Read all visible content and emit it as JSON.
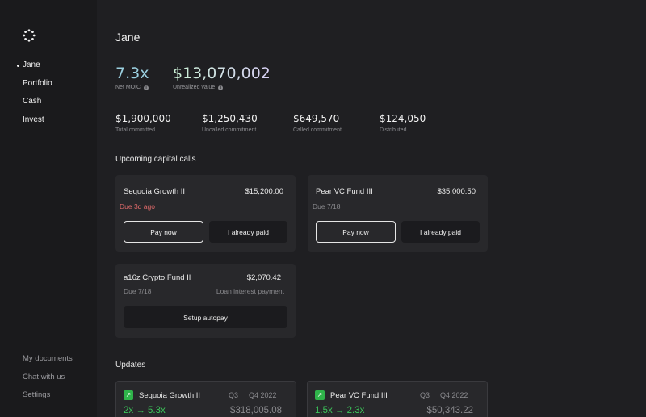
{
  "sidebar": {
    "logo_icon": "spinner-logo-icon",
    "items": [
      {
        "label": "Jane",
        "active": true
      },
      {
        "label": "Portfolio",
        "active": false
      },
      {
        "label": "Cash",
        "active": false
      },
      {
        "label": "Invest",
        "active": false
      }
    ],
    "bottom_items": [
      {
        "label": "My documents"
      },
      {
        "label": "Chat with us"
      },
      {
        "label": "Settings"
      }
    ]
  },
  "header": {
    "title": "Jane"
  },
  "summary": {
    "net_moic": {
      "value": "7.3x",
      "label": "Net MOIC"
    },
    "unrealized": {
      "value": "$13,070,002",
      "label": "Unrealized value"
    },
    "info_icon": "info-icon"
  },
  "stats": [
    {
      "value": "$1,900,000",
      "label": "Total committed"
    },
    {
      "value": "$1,250,430",
      "label": "Uncalled commitment"
    },
    {
      "value": "$649,570",
      "label": "Called commitment"
    },
    {
      "value": "$124,050",
      "label": "Distributed"
    }
  ],
  "capital_calls": {
    "title": "Upcoming capital calls",
    "cards": [
      {
        "name": "Sequoia Growth II",
        "amount": "$15,200.00",
        "due": "Due 3d ago",
        "overdue": true,
        "primary": "Pay now",
        "secondary": "I already paid"
      },
      {
        "name": "Pear VC Fund III",
        "amount": "$35,000.50",
        "due": "Due 7/18",
        "overdue": false,
        "primary": "Pay now",
        "secondary": "I already paid"
      },
      {
        "name": "a16z Crypto Fund II",
        "amount": "$2,070.42",
        "due": "Due 7/18",
        "note": "Loan interest payment",
        "action": "Setup autopay"
      }
    ]
  },
  "updates": {
    "title": "Updates",
    "cards": [
      {
        "name": "Sequoia Growth II",
        "q_from": "Q3",
        "q_to": "Q4 2022",
        "multiple": "2x → 5.3x",
        "value": "$318,005.08"
      },
      {
        "name": "Pear VC Fund III",
        "q_from": "Q3",
        "q_to": "Q4 2022",
        "multiple": "1.5x → 2.3x",
        "value": "$50,343.22"
      }
    ],
    "icon": "trend-up-icon"
  },
  "colors": {
    "background": "#1f1f22",
    "card": "#28282b",
    "overdue": "#e06a6a",
    "positive": "#3cc55a"
  }
}
